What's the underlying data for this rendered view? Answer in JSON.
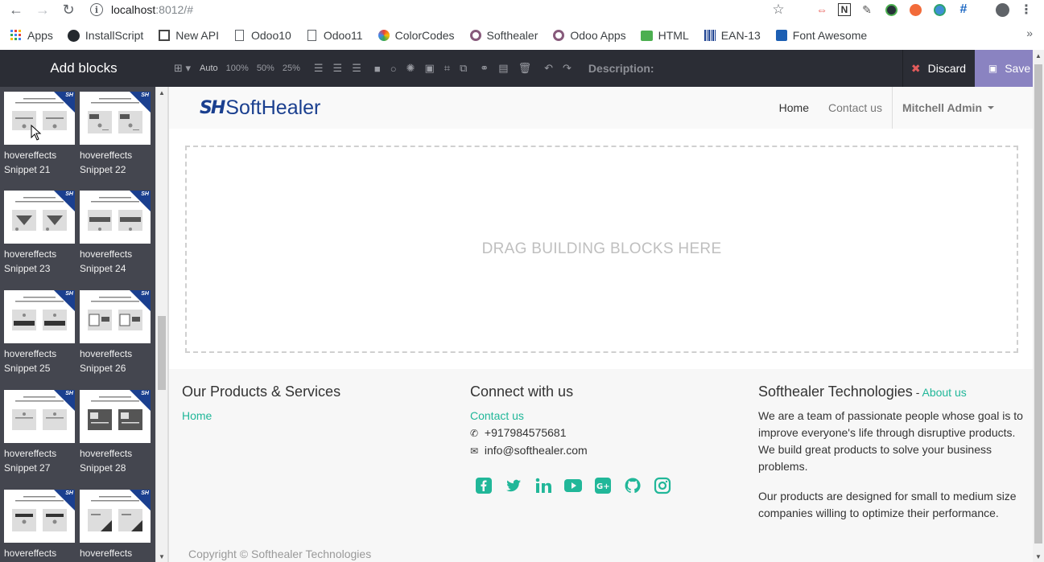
{
  "browser": {
    "url_host": "localhost",
    "url_rest": ":8012/#",
    "bookmarks": [
      {
        "label": "Apps",
        "icon": "apps-grid-icon"
      },
      {
        "label": "InstallScript",
        "icon": "github-icon"
      },
      {
        "label": "New API",
        "icon": "api-doc-icon"
      },
      {
        "label": "Odoo10",
        "icon": "page-icon"
      },
      {
        "label": "Odoo11",
        "icon": "page-icon"
      },
      {
        "label": "ColorCodes",
        "icon": "color-icon"
      },
      {
        "label": "Softhealer",
        "icon": "odoo-circle-icon"
      },
      {
        "label": "Odoo Apps",
        "icon": "odoo-circle-icon"
      },
      {
        "label": "HTML",
        "icon": "html-icon"
      },
      {
        "label": "EAN-13",
        "icon": "barcode-icon"
      },
      {
        "label": "Font Awesome",
        "icon": "flag-icon"
      }
    ],
    "bookmarks_more": "»"
  },
  "editor": {
    "add_blocks_title": "Add blocks",
    "toolbar": {
      "auto": "Auto",
      "size_100": "100%",
      "size_50": "50%",
      "size_25": "25%",
      "description_label": "Description:"
    },
    "discard_label": "Discard",
    "save_label": "Save"
  },
  "sidebar": {
    "snippets": [
      {
        "line1": "hovereffects",
        "line2": "Snippet 21"
      },
      {
        "line1": "hovereffects",
        "line2": "Snippet 22"
      },
      {
        "line1": "hovereffects",
        "line2": "Snippet 23"
      },
      {
        "line1": "hovereffects",
        "line2": "Snippet 24"
      },
      {
        "line1": "hovereffects",
        "line2": "Snippet 25"
      },
      {
        "line1": "hovereffects",
        "line2": "Snippet 26"
      },
      {
        "line1": "hovereffects",
        "line2": "Snippet 27"
      },
      {
        "line1": "hovereffects",
        "line2": "Snippet 28"
      },
      {
        "line1": "hovereffects",
        "line2": ""
      },
      {
        "line1": "hovereffects",
        "line2": ""
      }
    ],
    "badge_text": "SH"
  },
  "site": {
    "logo_mark": "SH",
    "logo_text": "SoftHealer",
    "nav": {
      "home": "Home",
      "contact": "Contact us",
      "user": "Mitchell Admin"
    },
    "drop_zone_text": "DRAG BUILDING BLOCKS HERE",
    "footer": {
      "col1_title": "Our Products & Services",
      "col1_link": "Home",
      "col2_title": "Connect with us",
      "col2_link": "Contact us",
      "phone": "+917984575681",
      "email": "info@softhealer.com",
      "col3_title": "Softhealer Technologies",
      "col3_title_sep": " - ",
      "col3_title_link": "About us",
      "col3_p1": "We are a team of passionate people whose goal is to improve everyone's life through disruptive products. We build great products to solve your business problems.",
      "col3_p2": "Our products are designed for small to medium size companies willing to optimize their performance.",
      "socials": [
        "facebook-icon",
        "twitter-icon",
        "linkedin-icon",
        "youtube-icon",
        "google-plus-icon",
        "github-icon",
        "instagram-icon"
      ]
    },
    "copyright": "Copyright © Softhealer Technologies"
  },
  "colors": {
    "accent": "#21b799",
    "brand": "#1a3f8f",
    "save": "#8a83c1",
    "editor_bar": "#2b2d35",
    "sidebar": "#44464f"
  }
}
